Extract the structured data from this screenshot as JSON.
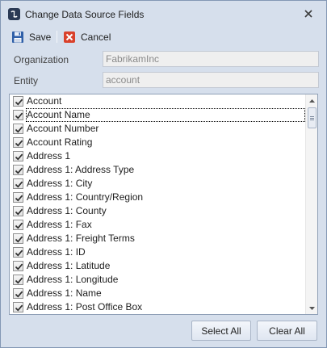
{
  "window": {
    "title": "Change Data Source Fields"
  },
  "toolbar": {
    "save_label": "Save",
    "cancel_label": "Cancel"
  },
  "form": {
    "organization_label": "Organization",
    "organization_value": "FabrikamInc",
    "entity_label": "Entity",
    "entity_value": "account"
  },
  "fields": {
    "items": [
      {
        "label": "Account",
        "checked": true
      },
      {
        "label": "Account Name",
        "checked": true
      },
      {
        "label": "Account Number",
        "checked": true
      },
      {
        "label": "Account Rating",
        "checked": true
      },
      {
        "label": "Address 1",
        "checked": true
      },
      {
        "label": "Address 1: Address Type",
        "checked": true
      },
      {
        "label": "Address 1: City",
        "checked": true
      },
      {
        "label": "Address 1: Country/Region",
        "checked": true
      },
      {
        "label": "Address 1: County",
        "checked": true
      },
      {
        "label": "Address 1: Fax",
        "checked": true
      },
      {
        "label": "Address 1: Freight Terms",
        "checked": true
      },
      {
        "label": "Address 1: ID",
        "checked": true
      },
      {
        "label": "Address 1: Latitude",
        "checked": true
      },
      {
        "label": "Address 1: Longitude",
        "checked": true
      },
      {
        "label": "Address 1: Name",
        "checked": true
      },
      {
        "label": "Address 1: Post Office Box",
        "checked": true
      }
    ],
    "focused_index": 1
  },
  "footer": {
    "select_all_label": "Select All",
    "clear_all_label": "Clear All"
  },
  "icons": {
    "app": "data-source-icon",
    "close": "close-icon",
    "save": "floppy-disk-icon",
    "cancel": "red-x-icon"
  },
  "colors": {
    "window_bg": "#d6dfec",
    "cancel_red": "#d9412b",
    "save_blue": "#2f5fa8"
  }
}
